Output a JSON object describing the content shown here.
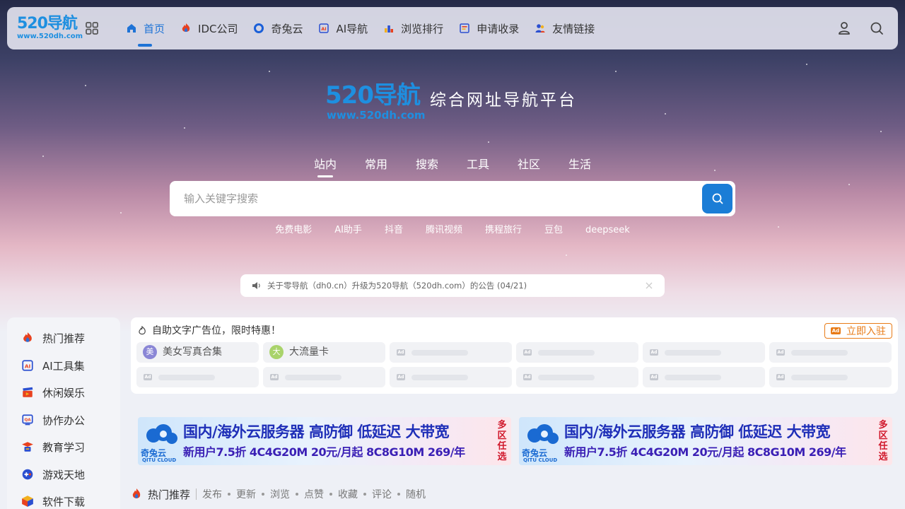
{
  "colors": {
    "accent": "#1e73d6",
    "brand": "#1e8fe0",
    "orange": "#e87b17"
  },
  "topnav": {
    "logo_main": "520导航",
    "logo_sub": "www.520dh.com",
    "items": [
      {
        "label": "首页",
        "icon": "home-icon",
        "active": true
      },
      {
        "label": "IDC公司",
        "icon": "flame-icon"
      },
      {
        "label": "奇兔云",
        "icon": "ring-icon"
      },
      {
        "label": "AI导航",
        "icon": "ai-box-icon"
      },
      {
        "label": "浏览排行",
        "icon": "bar-chart-icon"
      },
      {
        "label": "申请收录",
        "icon": "form-icon"
      },
      {
        "label": "友情链接",
        "icon": "people-icon"
      }
    ]
  },
  "hero": {
    "logo_main": "520导航",
    "logo_sub": "www.520dh.com",
    "slogan": "综合网址导航平台",
    "tabs": [
      "站内",
      "常用",
      "搜索",
      "工具",
      "社区",
      "生活"
    ],
    "active_tab": 0,
    "search_placeholder": "输入关键字搜索",
    "quick_links": [
      "免费电影",
      "AI助手",
      "抖音",
      "腾讯视频",
      "携程旅行",
      "豆包",
      "deepseek"
    ]
  },
  "notice": {
    "text": "关于零导航（dh0.cn）升级为520导航（520dh.com）的公告 (04/21)"
  },
  "sidebar": {
    "items": [
      {
        "label": "热门推荐",
        "icon": "flame-icon"
      },
      {
        "label": "AI工具集",
        "icon": "ai-box-icon"
      },
      {
        "label": "休闲娱乐",
        "icon": "clapper-icon"
      },
      {
        "label": "协作办公",
        "icon": "qa-screen-icon"
      },
      {
        "label": "教育学习",
        "icon": "graduation-cap-icon"
      },
      {
        "label": "游戏天地",
        "icon": "gamepad-icon"
      },
      {
        "label": "软件下载",
        "icon": "cube-icon"
      }
    ]
  },
  "ads": {
    "header": "自助文字广告位，限时特惠！",
    "join_label": "立即入驻",
    "ad_badge": "Ad",
    "slots": [
      {
        "avatar": "美",
        "label": "美女写真合集",
        "avatar_color": "#8a86d6"
      },
      {
        "avatar": "大",
        "label": "大流量卡",
        "avatar_color": "#a9d36b"
      }
    ]
  },
  "banners": [
    {
      "brand": "奇兔云",
      "brand_en": "QITU CLOUD",
      "line1": "国内/海外云服务器 高防御 低延迟 大带宽",
      "line2": "新用户7.5折 4C4G20M 20元/月起 8C8G10M 269/年",
      "side": "多区任选"
    },
    {
      "brand": "奇兔云",
      "brand_en": "QITU CLOUD",
      "line1": "国内/海外云服务器 高防御 低延迟 大带宽",
      "line2": "新用户7.5折 4C4G20M 20元/月起 8C8G10M 269/年",
      "side": "多区任选"
    }
  ],
  "hot": {
    "title": "热门推荐",
    "tabs": [
      "发布",
      "更新",
      "浏览",
      "点赞",
      "收藏",
      "评论",
      "随机"
    ]
  }
}
